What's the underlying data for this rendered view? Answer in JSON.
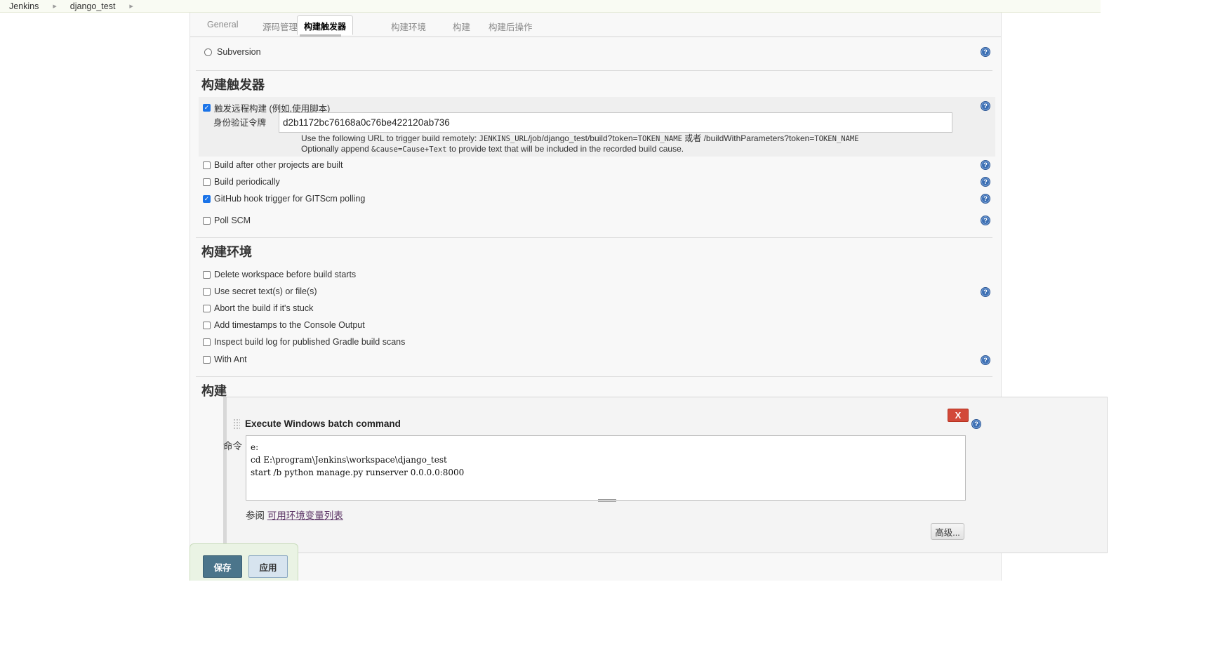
{
  "breadcrumb": {
    "root": "Jenkins",
    "job": "django_test"
  },
  "tabs": [
    "General",
    "源码管理",
    "构建触发器",
    "构建环境",
    "构建",
    "构建后操作"
  ],
  "scm": {
    "subversion_label": "Subversion"
  },
  "triggers": {
    "title": "构建触发器",
    "remote_label": "触发远程构建 (例如,使用脚本)",
    "token_label": "身份验证令牌",
    "token_value": "d2b1172bc76168a0c76be422120ab736",
    "hint1_prefix": "Use the following URL to trigger build remotely: ",
    "hint1_code1": "JENKINS_URL",
    "hint1_mid": "/job/django_test/build?token=",
    "hint1_code2": "TOKEN_NAME",
    "hint1_or": " 或者 /buildWithParameters?token=",
    "hint1_code3": "TOKEN_NAME",
    "hint2_prefix": "Optionally append ",
    "hint2_code": "&cause=Cause+Text",
    "hint2_suffix": " to provide text that will be included in the recorded build cause.",
    "after_other_label": "Build after other projects are built",
    "periodically_label": "Build periodically",
    "github_label": "GitHub hook trigger for GITScm polling",
    "poll_scm_label": "Poll SCM"
  },
  "environment": {
    "title": "构建环境",
    "items": [
      "Delete workspace before build starts",
      "Use secret text(s) or file(s)",
      "Abort the build if it's stuck",
      "Add timestamps to the Console Output",
      "Inspect build log for published Gradle build scans",
      "With Ant"
    ]
  },
  "build": {
    "title": "构建",
    "step_title": "Execute Windows batch command",
    "delete_label": "X",
    "command_label": "命令",
    "command_value": "e:\ncd E:\\program\\Jenkins\\workspace\\django_test\nstart /b python manage.py runserver 0.0.0.0:8000",
    "see_also_prefix": "参阅 ",
    "env_link": "可用环境变量列表",
    "advanced_label": "高级..."
  },
  "actions": {
    "save": "保存",
    "apply": "应用"
  },
  "help_glyph": "?",
  "check_glyph": "✓",
  "colors": {
    "save": "#4b758b",
    "apply": "#d7e4ef",
    "delete": "#d24939",
    "help": "#3c6fb3",
    "checkbox": "#1a73e8"
  }
}
